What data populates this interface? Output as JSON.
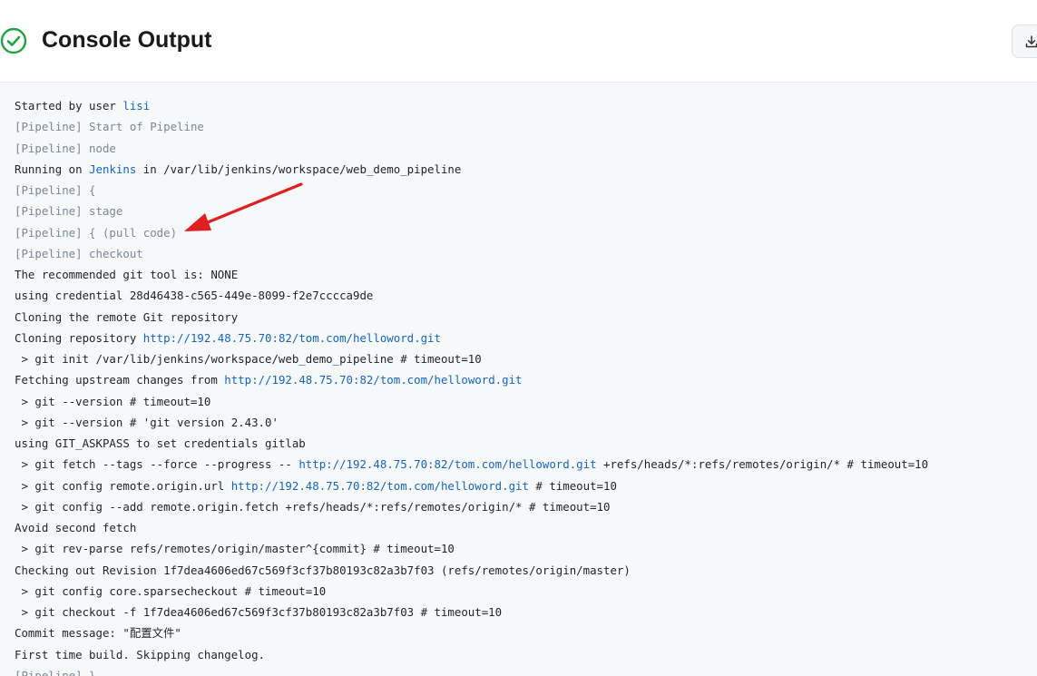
{
  "header": {
    "title": "Console Output",
    "status_icon": "check-circle-icon",
    "download_icon": "download-icon",
    "colors": {
      "success": "#1ea446",
      "link": "#1565c0",
      "pipeline": "#7b8794",
      "annotation": "#e02020"
    }
  },
  "console": {
    "lines": [
      {
        "segments": [
          {
            "t": "Started by user "
          },
          {
            "t": "lisi",
            "link": true
          }
        ]
      },
      {
        "segments": [
          {
            "t": "[Pipeline] Start of Pipeline",
            "pl": true
          }
        ]
      },
      {
        "segments": [
          {
            "t": "[Pipeline] node",
            "pl": true
          }
        ]
      },
      {
        "segments": [
          {
            "t": "Running on "
          },
          {
            "t": "Jenkins",
            "link": true
          },
          {
            "t": " in /var/lib/jenkins/workspace/web_demo_pipeline"
          }
        ]
      },
      {
        "segments": [
          {
            "t": "[Pipeline] {",
            "pl": true
          }
        ]
      },
      {
        "segments": [
          {
            "t": "[Pipeline] stage",
            "pl": true
          }
        ]
      },
      {
        "segments": [
          {
            "t": "[Pipeline] { (pull code)",
            "pl": true
          }
        ]
      },
      {
        "segments": [
          {
            "t": "[Pipeline] checkout",
            "pl": true
          }
        ]
      },
      {
        "segments": [
          {
            "t": "The recommended git tool is: NONE"
          }
        ]
      },
      {
        "segments": [
          {
            "t": "using credential 28d46438-c565-449e-8099-f2e7cccca9de"
          }
        ]
      },
      {
        "segments": [
          {
            "t": "Cloning the remote Git repository"
          }
        ]
      },
      {
        "segments": [
          {
            "t": "Cloning repository "
          },
          {
            "t": "http://192.48.75.70:82/tom.com/helloword.git",
            "link": true
          }
        ]
      },
      {
        "segments": [
          {
            "t": " > git init /var/lib/jenkins/workspace/web_demo_pipeline # timeout=10"
          }
        ]
      },
      {
        "segments": [
          {
            "t": "Fetching upstream changes from "
          },
          {
            "t": "http://192.48.75.70:82/tom.com/helloword.git",
            "link": true
          }
        ]
      },
      {
        "segments": [
          {
            "t": " > git --version # timeout=10"
          }
        ]
      },
      {
        "segments": [
          {
            "t": " > git --version # 'git version 2.43.0'"
          }
        ]
      },
      {
        "segments": [
          {
            "t": "using GIT_ASKPASS to set credentials gitlab"
          }
        ]
      },
      {
        "segments": [
          {
            "t": " > git fetch --tags --force --progress -- "
          },
          {
            "t": "http://192.48.75.70:82/tom.com/helloword.git",
            "link": true
          },
          {
            "t": " +refs/heads/*:refs/remotes/origin/* # timeout=10"
          }
        ]
      },
      {
        "segments": [
          {
            "t": " > git config remote.origin.url "
          },
          {
            "t": "http://192.48.75.70:82/tom.com/helloword.git",
            "link": true
          },
          {
            "t": " # timeout=10"
          }
        ]
      },
      {
        "segments": [
          {
            "t": " > git config --add remote.origin.fetch +refs/heads/*:refs/remotes/origin/* # timeout=10"
          }
        ]
      },
      {
        "segments": [
          {
            "t": "Avoid second fetch"
          }
        ]
      },
      {
        "segments": [
          {
            "t": " > git rev-parse refs/remotes/origin/master^{commit} # timeout=10"
          }
        ]
      },
      {
        "segments": [
          {
            "t": "Checking out Revision 1f7dea4606ed67c569f3cf37b80193c82a3b7f03 (refs/remotes/origin/master)"
          }
        ]
      },
      {
        "segments": [
          {
            "t": " > git config core.sparsecheckout # timeout=10"
          }
        ]
      },
      {
        "segments": [
          {
            "t": " > git checkout -f 1f7dea4606ed67c569f3cf37b80193c82a3b7f03 # timeout=10"
          }
        ]
      },
      {
        "segments": [
          {
            "t": "Commit message: \"配置文件\""
          }
        ]
      },
      {
        "segments": [
          {
            "t": "First time build. Skipping changelog."
          }
        ]
      },
      {
        "segments": [
          {
            "t": "[Pipeline] }",
            "pl": true
          }
        ]
      }
    ]
  }
}
